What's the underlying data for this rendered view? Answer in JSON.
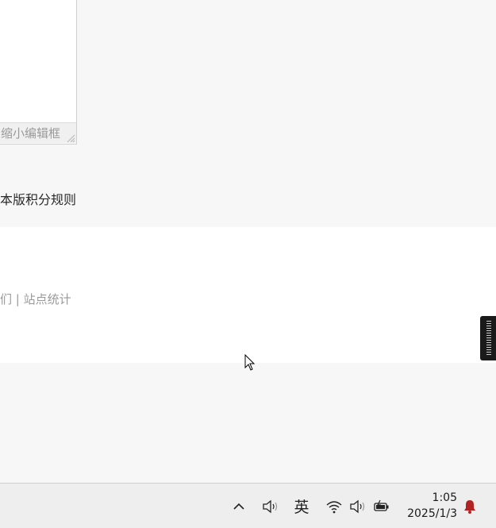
{
  "editor": {
    "shrink_label": "缩小编辑框"
  },
  "rules": {
    "label": "本版积分规则"
  },
  "footer": {
    "links_text": "们 | 站点统计"
  },
  "taskbar": {
    "ime_label": "英",
    "time": "1:05",
    "date": "2025/1/3"
  },
  "icons": {
    "tray_expand": "chevron-up-icon",
    "speaker": "speaker-icon",
    "wifi": "wifi-icon",
    "volume": "volume-icon",
    "battery": "battery-charging-icon",
    "notification": "bell-icon"
  },
  "colors": {
    "notification_bell": "#b22222",
    "side_tab": "#1a1a1a"
  }
}
